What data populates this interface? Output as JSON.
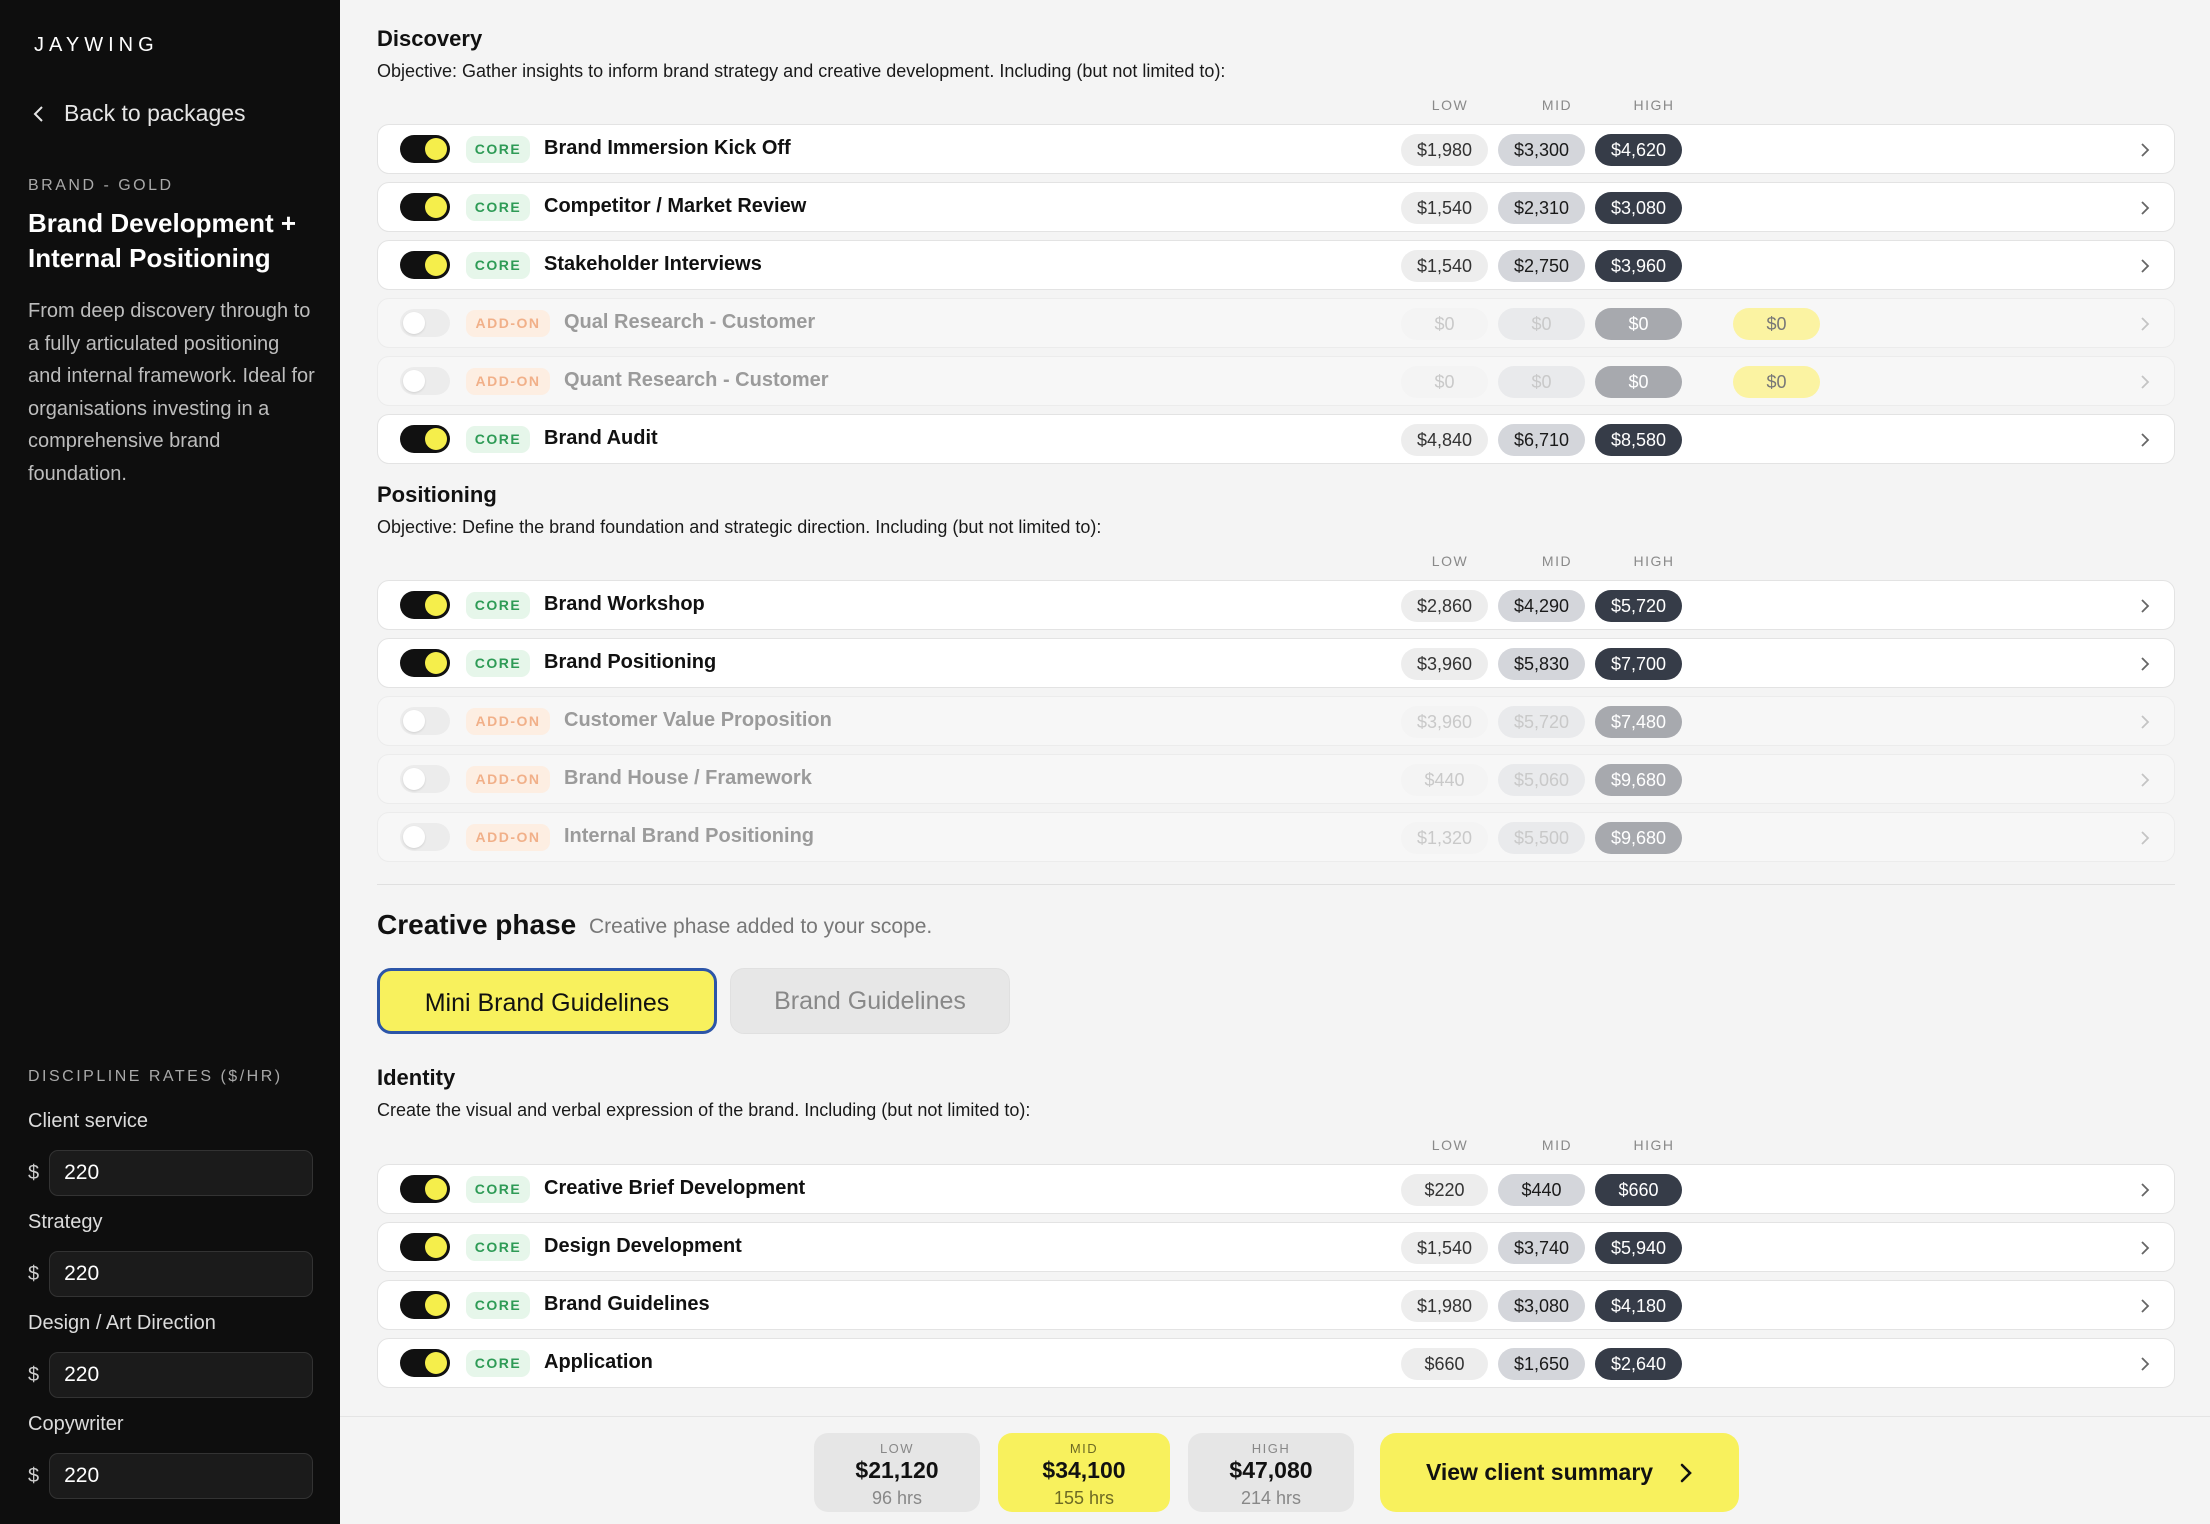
{
  "sidebar": {
    "logo": "JAYWING",
    "back_label": "Back to packages",
    "package_tier": "BRAND - GOLD",
    "package_title": "Brand Development + Internal Positioning",
    "package_desc": "From deep discovery through to a fully articulated positioning and internal framework. Ideal for organisations investing in a comprehensive brand foundation.",
    "rates_title": "DISCIPLINE RATES ($/HR)",
    "currency": "$",
    "rates": [
      {
        "label": "Client service",
        "value": "220"
      },
      {
        "label": "Strategy",
        "value": "220"
      },
      {
        "label": "Design / Art Direction",
        "value": "220"
      },
      {
        "label": "Copywriter",
        "value": "220"
      }
    ]
  },
  "columns": {
    "low": "LOW",
    "mid": "MID",
    "high": "HIGH"
  },
  "sections": {
    "discovery": {
      "title": "Discovery",
      "objective": "Objective: Gather insights to inform brand strategy and creative development. Including (but not limited to):",
      "rows": [
        {
          "enabled": true,
          "badge": "CORE",
          "name": "Brand Immersion Kick Off",
          "low": "$1,980",
          "mid": "$3,300",
          "high": "$4,620"
        },
        {
          "enabled": true,
          "badge": "CORE",
          "name": "Competitor / Market Review",
          "low": "$1,540",
          "mid": "$2,310",
          "high": "$3,080"
        },
        {
          "enabled": true,
          "badge": "CORE",
          "name": "Stakeholder Interviews",
          "low": "$1,540",
          "mid": "$2,750",
          "high": "$3,960"
        },
        {
          "enabled": false,
          "badge": "ADD-ON",
          "name": "Qual Research - Customer",
          "extra": "$0",
          "low": "$0",
          "mid": "$0",
          "high": "$0"
        },
        {
          "enabled": false,
          "badge": "ADD-ON",
          "name": "Quant Research - Customer",
          "extra": "$0",
          "low": "$0",
          "mid": "$0",
          "high": "$0"
        },
        {
          "enabled": true,
          "badge": "CORE",
          "name": "Brand Audit",
          "low": "$4,840",
          "mid": "$6,710",
          "high": "$8,580"
        }
      ]
    },
    "positioning": {
      "title": "Positioning",
      "objective": "Objective: Define the brand foundation and strategic direction. Including (but not limited to):",
      "rows": [
        {
          "enabled": true,
          "badge": "CORE",
          "name": "Brand Workshop",
          "low": "$2,860",
          "mid": "$4,290",
          "high": "$5,720"
        },
        {
          "enabled": true,
          "badge": "CORE",
          "name": "Brand Positioning",
          "low": "$3,960",
          "mid": "$5,830",
          "high": "$7,700"
        },
        {
          "enabled": false,
          "badge": "ADD-ON",
          "name": "Customer Value Proposition",
          "low": "$3,960",
          "mid": "$5,720",
          "high": "$7,480"
        },
        {
          "enabled": false,
          "badge": "ADD-ON",
          "name": "Brand House / Framework",
          "low": "$440",
          "mid": "$5,060",
          "high": "$9,680"
        },
        {
          "enabled": false,
          "badge": "ADD-ON",
          "name": "Internal Brand Positioning",
          "low": "$1,320",
          "mid": "$5,500",
          "high": "$9,680"
        }
      ]
    },
    "identity": {
      "title": "Identity",
      "objective": "Create the visual and verbal expression of the brand. Including (but not limited to):",
      "rows": [
        {
          "enabled": true,
          "badge": "CORE",
          "name": "Creative Brief Development",
          "low": "$220",
          "mid": "$440",
          "high": "$660"
        },
        {
          "enabled": true,
          "badge": "CORE",
          "name": "Design Development",
          "low": "$1,540",
          "mid": "$3,740",
          "high": "$5,940"
        },
        {
          "enabled": true,
          "badge": "CORE",
          "name": "Brand Guidelines",
          "low": "$1,980",
          "mid": "$3,080",
          "high": "$4,180"
        },
        {
          "enabled": true,
          "badge": "CORE",
          "name": "Application",
          "low": "$660",
          "mid": "$1,650",
          "high": "$2,640"
        }
      ]
    }
  },
  "creative": {
    "title": "Creative phase",
    "subtitle": "Creative phase added to your scope.",
    "options": [
      "Mini Brand Guidelines",
      "Brand Guidelines"
    ],
    "selected": "Mini Brand Guidelines"
  },
  "footer": {
    "low": {
      "label": "LOW",
      "amount": "$21,120",
      "hours": "96 hrs"
    },
    "mid": {
      "label": "MID",
      "amount": "$34,100",
      "hours": "155 hrs"
    },
    "high": {
      "label": "HIGH",
      "amount": "$47,080",
      "hours": "214 hrs"
    },
    "cta_label": "View client summary"
  },
  "colors": {
    "accent_yellow": "#f8f15d",
    "dark": "#0e0e0e",
    "high_pill": "#363c48",
    "core_green": "#2e9b56",
    "addon_orange": "#f1b089",
    "focus_blue": "#2c55a8"
  }
}
